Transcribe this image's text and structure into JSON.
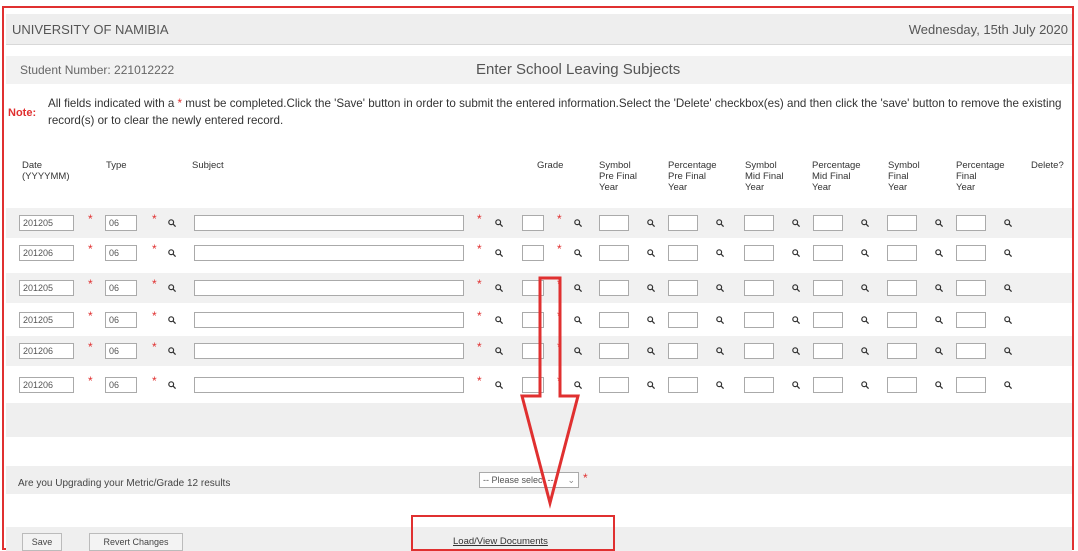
{
  "header": {
    "university": "UNIVERSITY OF NAMIBIA",
    "date": "Wednesday, 15th July 2020"
  },
  "student": {
    "label": "Student Number: 221012222",
    "page_title": "Enter School Leaving Subjects"
  },
  "note": {
    "label": "Note:",
    "text_before": "All fields indicated with a ",
    "star": "*",
    "text_after": " must be completed.Click the 'Save' button in order to submit the entered information.Select the 'Delete' checkbox(es) and then click the 'save' button to remove the existing record(s) or to clear the newly entered record."
  },
  "columns": {
    "date_1": "Date",
    "date_2": "(YYYYMM)",
    "type": "Type",
    "subject": "Subject",
    "grade": "Grade",
    "sym_pre_1": "Symbol",
    "sym_pre_2": "Pre Final",
    "sym_pre_3": "Year",
    "pct_pre_1": "Percentage",
    "pct_pre_2": "Pre Final",
    "pct_pre_3": "Year",
    "sym_mid_1": "Symbol",
    "sym_mid_2": "Mid Final",
    "sym_mid_3": "Year",
    "pct_mid_1": "Percentage",
    "pct_mid_2": "Mid Final",
    "pct_mid_3": "Year",
    "sym_fin_1": "Symbol",
    "sym_fin_2": "Final",
    "sym_fin_3": "Year",
    "pct_fin_1": "Percentage",
    "pct_fin_2": "Final",
    "pct_fin_3": "Year",
    "delete": "Delete?"
  },
  "rows": [
    {
      "date": "201205",
      "type": "06"
    },
    {
      "date": "201206",
      "type": "06"
    },
    {
      "date": "201205",
      "type": "06"
    },
    {
      "date": "201205",
      "type": "06"
    },
    {
      "date": "201206",
      "type": "06"
    },
    {
      "date": "201206",
      "type": "06"
    }
  ],
  "upgrade": {
    "question": "Are you Upgrading your Metric/Grade 12 results",
    "select_value": "-- Please select --",
    "required": "*"
  },
  "buttons": {
    "save": "Save",
    "revert": "Revert Changes",
    "documents": "Load/View Documents"
  },
  "colors": {
    "annotation": "#e03030",
    "required": "#e03030",
    "row_alt": "#f1f1f1"
  },
  "icons": {
    "lookup": "magnifier-icon"
  }
}
